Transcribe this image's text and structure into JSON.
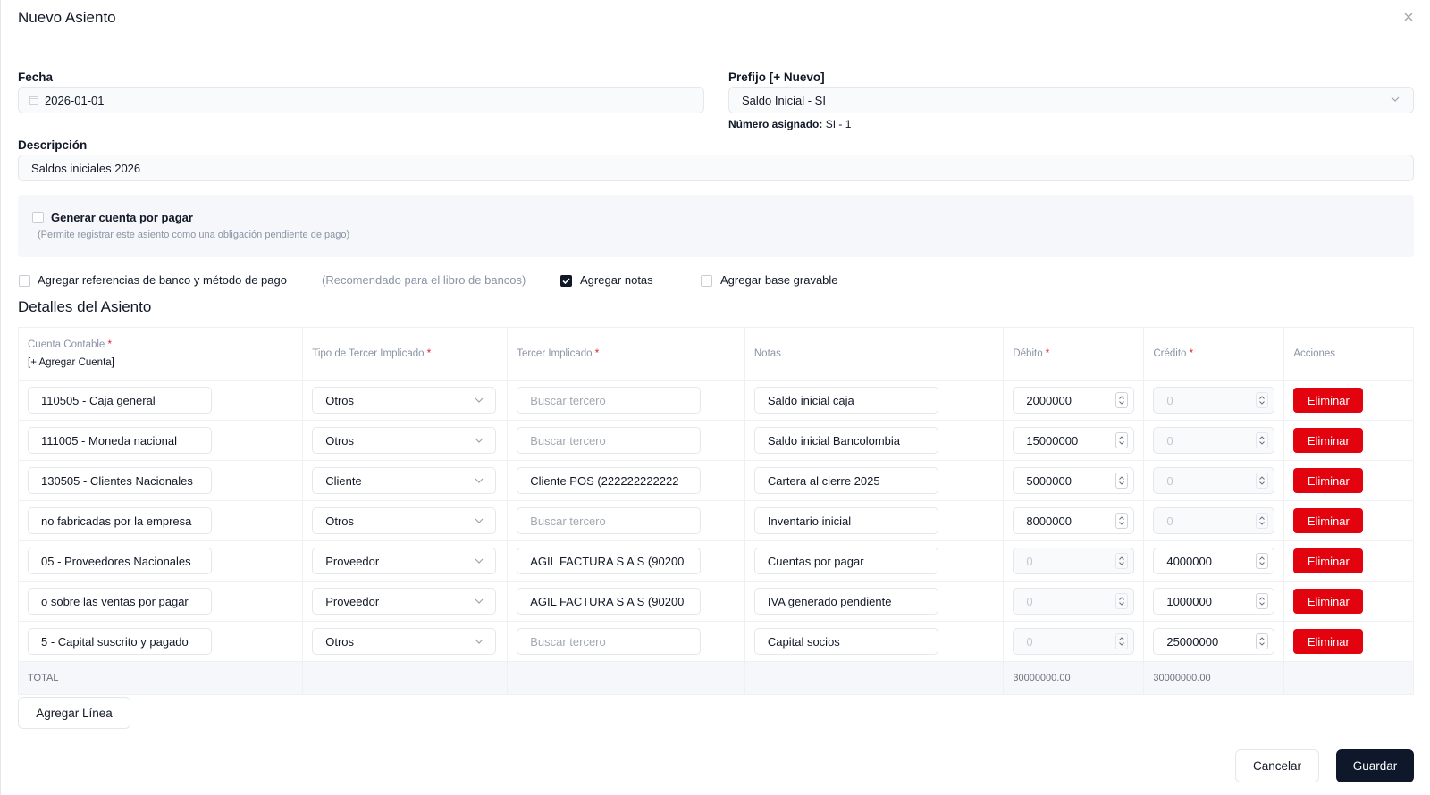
{
  "modal": {
    "title": "Nuevo Asiento",
    "close_icon": "close-icon"
  },
  "form": {
    "fecha_label": "Fecha",
    "fecha_value": "2026-01-01",
    "prefijo_label": "Prefijo [+ Nuevo]",
    "prefijo_value": "Saldo Inicial - SI",
    "numero_label": "Número asignado:",
    "numero_value": "SI - 1",
    "descripcion_label": "Descripción",
    "descripcion_value": "Saldos iniciales 2026"
  },
  "cuenta_por_pagar": {
    "label": "Generar cuenta por pagar",
    "help": "(Permite registrar este asiento como una obligación pendiente de pago)",
    "checked": false
  },
  "options": {
    "banco_label": "Agregar referencias de banco y método de pago",
    "banco_hint": "(Recomendado para el libro de bancos)",
    "banco_checked": false,
    "notas_label": "Agregar notas",
    "notas_checked": true,
    "base_label": "Agregar base gravable",
    "base_checked": false
  },
  "details": {
    "title": "Detalles del Asiento",
    "headers": {
      "cuenta": "Cuenta Contable",
      "agregar_cuenta": "[+ Agregar Cuenta]",
      "tipo": "Tipo de Tercer Implicado",
      "tercero": "Tercer Implicado",
      "notas": "Notas",
      "debito": "Débito",
      "credito": "Crédito",
      "acciones": "Acciones",
      "required_mark": "*"
    },
    "tercero_placeholder": "Buscar tercero",
    "delete_label": "Eliminar",
    "rows": [
      {
        "cuenta": "110505 - Caja general",
        "tipo": "Otros",
        "tercero": "",
        "notas": "Saldo inicial caja",
        "debito": "2000000",
        "credito": "0"
      },
      {
        "cuenta": "111005 - Moneda nacional",
        "tipo": "Otros",
        "tercero": "",
        "notas": "Saldo inicial Bancolombia",
        "debito": "15000000",
        "credito": "0"
      },
      {
        "cuenta": "130505 - Clientes Nacionales",
        "tipo": "Cliente",
        "tercero": "Cliente POS (222222222222",
        "notas": "Cartera al cierre 2025",
        "debito": "5000000",
        "credito": "0"
      },
      {
        "cuenta": "no fabricadas por la empresa",
        "tipo": "Otros",
        "tercero": "",
        "notas": "Inventario inicial",
        "debito": "8000000",
        "credito": "0"
      },
      {
        "cuenta": "05 - Proveedores Nacionales",
        "tipo": "Proveedor",
        "tercero": "AGIL FACTURA S A S (90200",
        "notas": "Cuentas por pagar",
        "debito": "0",
        "credito": "4000000"
      },
      {
        "cuenta": "o sobre las ventas por pagar",
        "tipo": "Proveedor",
        "tercero": "AGIL FACTURA S A S (90200",
        "notas": "IVA generado pendiente",
        "debito": "0",
        "credito": "1000000"
      },
      {
        "cuenta": "5 - Capital suscrito y pagado",
        "tipo": "Otros",
        "tercero": "",
        "notas": "Capital socios",
        "debito": "0",
        "credito": "25000000"
      }
    ],
    "total_label": "TOTAL",
    "total_debito": "30000000.00",
    "total_credito": "30000000.00"
  },
  "actions": {
    "add_line": "Agregar Línea",
    "cancel": "Cancelar",
    "save": "Guardar"
  },
  "colors": {
    "primary_dark": "#0f172a",
    "danger": "#e3030f",
    "muted": "#8a94a6"
  }
}
